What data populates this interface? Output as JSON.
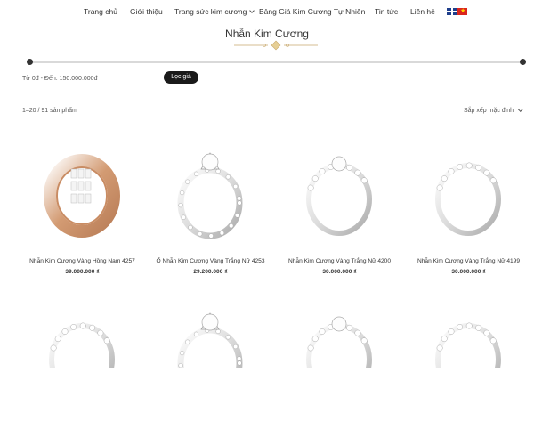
{
  "nav": {
    "items": [
      {
        "label": "Trang chủ"
      },
      {
        "label": "Giới thiệu"
      },
      {
        "label": "Trang sức kim cương"
      },
      {
        "label": "Bảng Giá Kim Cương Tự Nhiên"
      },
      {
        "label": "Tin tức"
      },
      {
        "label": "Liên hệ"
      }
    ],
    "languages": [
      "english-flag",
      "vietnam-flag"
    ]
  },
  "page": {
    "title": "Nhẫn Kim Cương"
  },
  "filter": {
    "price_range": "Từ 0đ - Đến: 150.000.000đ",
    "button_label": "Lọc giá",
    "min_value": 0,
    "max_value": 150000000
  },
  "results": {
    "count_text": "1–20 / 91 sản phẩm",
    "sort_label": "Sắp xếp mặc định"
  },
  "products": [
    {
      "name": "Nhẫn Kim Cương Vàng Hồng Nam 4257",
      "price": "39.000.000 ₫",
      "metal": "rose-gold"
    },
    {
      "name": "Ổ Nhẫn Kim Cương Vàng Trắng Nữ 4253",
      "price": "29.200.000 ₫",
      "metal": "white-gold"
    },
    {
      "name": "Nhẫn Kim Cương Vàng Trắng Nữ 4200",
      "price": "30.000.000 ₫",
      "metal": "white-gold"
    },
    {
      "name": "Nhẫn Kim Cương Vàng Trắng Nữ 4199",
      "price": "30.000.000 ₫",
      "metal": "white-gold"
    },
    {
      "name": "",
      "price": "",
      "metal": "white-gold"
    },
    {
      "name": "",
      "price": "",
      "metal": "white-gold"
    },
    {
      "name": "",
      "price": "",
      "metal": "white-gold"
    },
    {
      "name": "",
      "price": "",
      "metal": "white-gold"
    }
  ],
  "colors": {
    "text": "#333333",
    "accent": "#c9a96e",
    "button": "#1a1a1a",
    "rose_gold": "#d39b73",
    "white_gold": "#d8d8d8"
  }
}
